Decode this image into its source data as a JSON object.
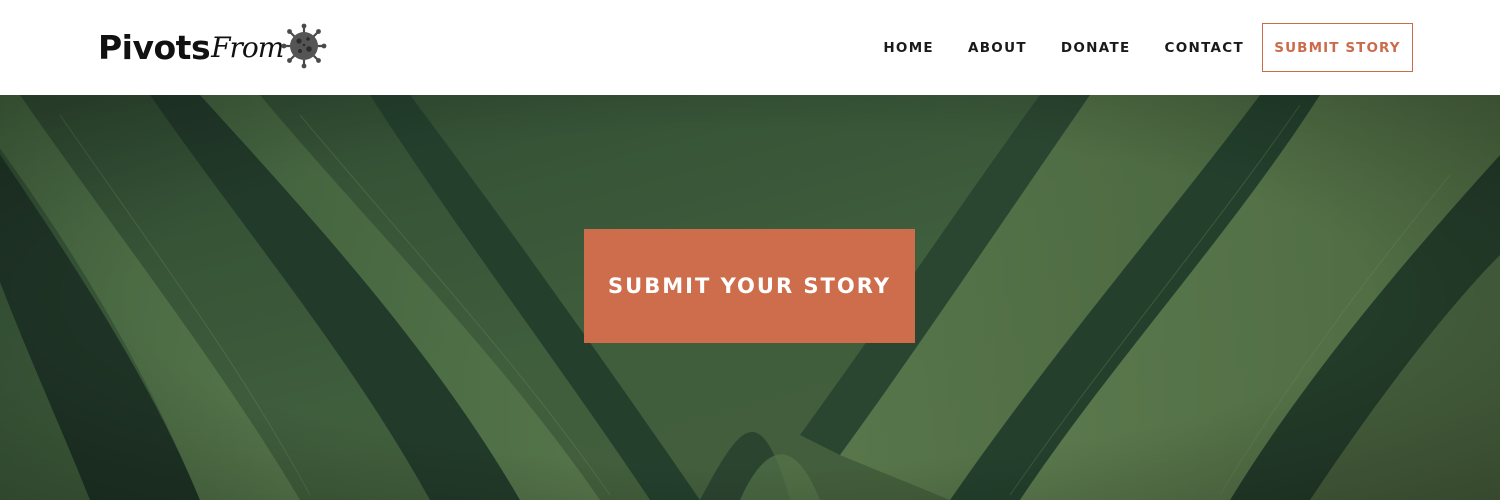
{
  "brand": {
    "name_bold": "Pivots",
    "name_script": "From",
    "icon": "virus-icon",
    "accent_color": "#cd6d4b"
  },
  "nav": {
    "items": [
      {
        "label": "HOME"
      },
      {
        "label": "ABOUT"
      },
      {
        "label": "DONATE"
      },
      {
        "label": "CONTACT"
      }
    ],
    "cta_label": "SUBMIT STORY"
  },
  "hero": {
    "background": "leaf-texture-image",
    "cta_label": "SUBMIT YOUR STORY"
  }
}
